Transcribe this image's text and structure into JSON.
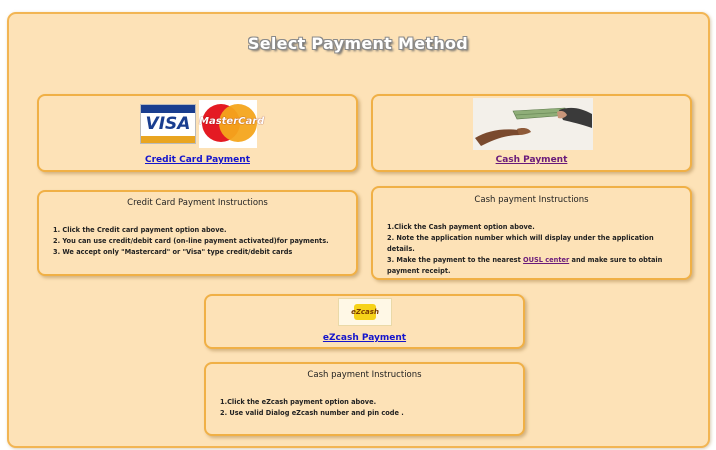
{
  "page": {
    "title": "Select Payment Method"
  },
  "credit_card": {
    "link_label": "Credit Card Payment",
    "logos": {
      "visa": "VISA",
      "mastercard": "MasterCard"
    }
  },
  "cash": {
    "link_label": "Cash Payment"
  },
  "credit_instructions": {
    "title": "Credit Card Payment Instructions",
    "items": [
      "1. Click the Credit card payment option above.",
      "2. You can use credit/debit card (on-line payment activated)for payments.",
      "3. We accept only \"Mastercard\" or \"Visa\" type credit/debit cards"
    ]
  },
  "cash_instructions": {
    "title": "Cash payment Instructions",
    "item1": "1.Click the Cash payment option above.",
    "item2": "2. Note the application number which will display under the application details.",
    "item3_prefix": "3. Make the payment to the nearest ",
    "item3_link": "OUSL center",
    "item3_suffix": " and make sure to obtain payment receipt."
  },
  "ezcash": {
    "link_label": "eZcash Payment",
    "logo_text": "eZcash"
  },
  "ezcash_instructions": {
    "title": "Cash payment Instructions",
    "items": [
      "1.Click the eZcash payment option above.",
      "2. Use valid Dialog eZcash number and pin code ."
    ]
  },
  "colors": {
    "panel_bg": "#fde2b7",
    "panel_border": "#f0b046",
    "link_blue": "#1515cc",
    "link_purple": "#6a1b7a"
  }
}
